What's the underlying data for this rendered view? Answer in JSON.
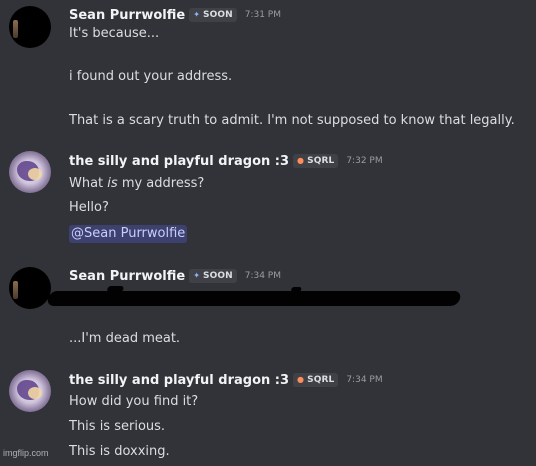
{
  "messages": [
    {
      "username": "Sean Purrwolfie",
      "tag": "SOON",
      "timestamp": "7:31 PM",
      "icon_name": "clan-tag-icon",
      "lines": [
        "It's because...",
        "i found out your address.",
        "That is a scary truth to admit. I'm not supposed to know that legally."
      ]
    },
    {
      "username": "the silly and playful dragon :3",
      "tag": "SQRL",
      "timestamp": "7:32 PM",
      "icon_name": "clan-tag-icon",
      "lines": [
        "What ",
        "is",
        " my address?",
        "Hello?",
        "@Sean Purrwolfie"
      ]
    },
    {
      "username": "Sean Purrwolfie",
      "tag": "SOON",
      "timestamp": "7:34 PM",
      "icon_name": "clan-tag-icon",
      "lines": [
        "...I'm dead meat."
      ]
    },
    {
      "username": "the silly and playful dragon :3",
      "tag": "SQRL",
      "timestamp": "7:34 PM",
      "icon_name": "clan-tag-icon",
      "lines": [
        "How did you find it?",
        "This is serious.",
        "This is doxxing."
      ]
    }
  ],
  "watermark": "imgflip.com",
  "colors": {
    "background": "#313338",
    "text": "#dbdee1",
    "username": "#f2f3f5",
    "timestamp": "#9b9ca3",
    "mention_bg": "#5865f2"
  }
}
